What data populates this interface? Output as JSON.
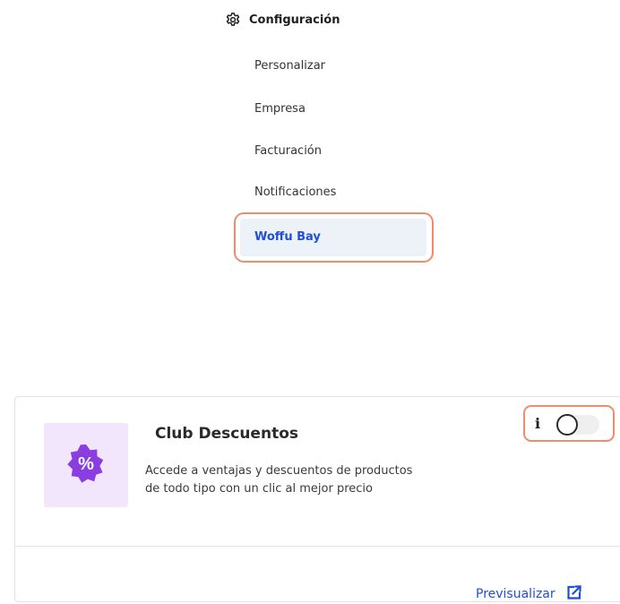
{
  "nav": {
    "header_label": "Configuración",
    "header_icon": "gear-icon",
    "items": [
      {
        "label": "Personalizar",
        "active": false
      },
      {
        "label": "Empresa",
        "active": false
      },
      {
        "label": "Facturación",
        "active": false
      },
      {
        "label": "Notificaciones",
        "active": false
      },
      {
        "label": "Woffu Bay",
        "active": true
      }
    ]
  },
  "card": {
    "title": "Club Descuentos",
    "description_line1": "Accede a ventajas y descuentos de productos",
    "description_line2": "de todo tipo con un clic al mejor precio",
    "icon": "discount-badge-icon",
    "info_icon_label": "i",
    "toggle_enabled": false,
    "preview_label": "Previsualizar",
    "preview_icon": "external-link-icon"
  },
  "colors": {
    "accent_blue": "#1f4fd6",
    "highlight_orange": "#f08c6c",
    "badge_purple": "#8a3ee0",
    "icon_bg": "#f1e6fb",
    "active_bg": "#edf1f8"
  }
}
